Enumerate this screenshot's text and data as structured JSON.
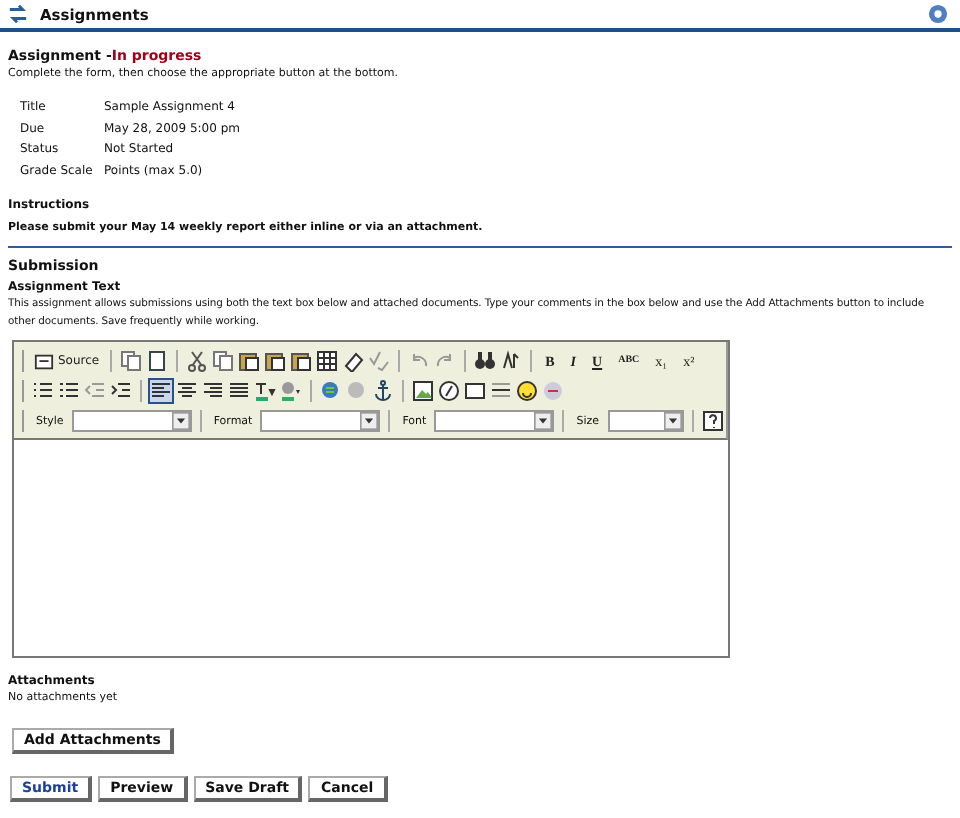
{
  "header": {
    "title": "Assignments"
  },
  "assignment": {
    "heading": "Assignment -",
    "status": "In progress",
    "intro": "Complete the form, then choose the appropriate button at the bottom."
  },
  "details": [
    {
      "label": "Title",
      "value": "Sample Assignment 4"
    },
    {
      "label": "Due",
      "value": "May 28, 2009 5:00 pm"
    },
    {
      "label": "Status",
      "value": "Not Started"
    },
    {
      "label": "Grade Scale",
      "value": "Points (max 5.0)"
    }
  ],
  "instructions": {
    "heading": "Instructions",
    "text": "Please submit your May 14 weekly report either inline or via an attachment."
  },
  "submission": {
    "heading": "Submission",
    "text_heading": "Assignment Text",
    "help": "This assignment allows submissions using both the text box below and attached documents. Type your comments in the box below and use the Add Attachments button to include other documents. Save frequently while working."
  },
  "toolbar": [
    [
      {
        "kind": "source",
        "label": "Source"
      },
      {
        "kind": "sep"
      },
      {
        "kind": "icon"
      },
      {
        "kind": "icon"
      },
      {
        "kind": "sep"
      },
      {
        "kind": "icon"
      },
      {
        "kind": "icon"
      },
      {
        "kind": "icon"
      },
      {
        "kind": "icon"
      },
      {
        "kind": "icon"
      },
      {
        "kind": "icon"
      },
      {
        "kind": "icon"
      },
      {
        "kind": "icon"
      },
      {
        "kind": "sep"
      },
      {
        "kind": "icon"
      },
      {
        "kind": "icon"
      },
      {
        "kind": "sep"
      },
      {
        "kind": "icon"
      },
      {
        "kind": "icon"
      },
      {
        "kind": "sep"
      },
      {
        "kind": "glyph",
        "label": "B"
      },
      {
        "kind": "glyph",
        "label": "I"
      },
      {
        "kind": "glyph",
        "label": "U"
      },
      {
        "kind": "glyph",
        "label": "ABC"
      },
      {
        "kind": "glyph",
        "label": "x₁"
      },
      {
        "kind": "glyph",
        "label": "x²"
      }
    ],
    [
      {
        "kind": "icon"
      },
      {
        "kind": "icon"
      },
      {
        "kind": "icon"
      },
      {
        "kind": "icon"
      },
      {
        "kind": "sep"
      },
      {
        "kind": "icon",
        "selected": true
      },
      {
        "kind": "icon",
        "selected": false
      },
      {
        "kind": "icon",
        "selected": false
      },
      {
        "kind": "icon",
        "selected": false
      },
      {
        "kind": "icon"
      },
      {
        "kind": "icon"
      },
      {
        "kind": "sep"
      },
      {
        "kind": "icon"
      },
      {
        "kind": "icon"
      },
      {
        "kind": "icon"
      },
      {
        "kind": "sep"
      },
      {
        "kind": "icon"
      },
      {
        "kind": "icon"
      },
      {
        "kind": "icon"
      },
      {
        "kind": "icon"
      },
      {
        "kind": "icon"
      },
      {
        "kind": "icon"
      }
    ],
    [
      {
        "kind": "dropdown",
        "label": "Style"
      },
      {
        "kind": "sep"
      },
      {
        "kind": "dropdown",
        "label": "Format"
      },
      {
        "kind": "sep"
      },
      {
        "kind": "dropdown",
        "label": "Font"
      },
      {
        "kind": "sep"
      },
      {
        "kind": "dropdown",
        "label": "Size"
      },
      {
        "kind": "sep"
      },
      {
        "kind": "icon"
      }
    ]
  ],
  "attachments": {
    "heading": "Attachments",
    "text": "No attachments yet",
    "button": "Add Attachments"
  },
  "actions": [
    {
      "label": "Submit",
      "primary": true
    },
    {
      "label": "Preview",
      "primary": false
    },
    {
      "label": "Save Draft",
      "primary": false
    },
    {
      "label": "Cancel",
      "primary": false
    }
  ]
}
